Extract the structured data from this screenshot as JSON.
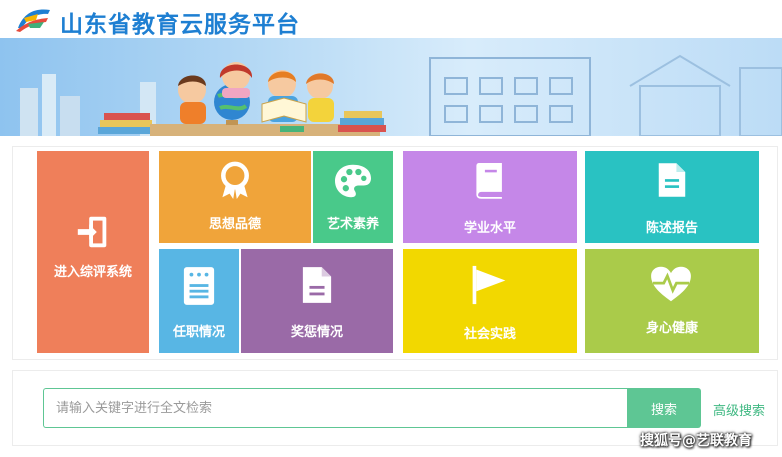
{
  "header": {
    "title": "山东省教育云服务平台"
  },
  "tiles": {
    "enter": {
      "label": "进入综评系统",
      "color": "#ef7f5a",
      "icon": "enter-door-icon"
    },
    "moral": {
      "label": "思想品德",
      "color": "#f0a43a",
      "icon": "award-ribbon-icon"
    },
    "art": {
      "label": "艺术素养",
      "color": "#49c98a",
      "icon": "palette-icon"
    },
    "academic": {
      "label": "学业水平",
      "color": "#c587e8",
      "icon": "book-icon"
    },
    "report": {
      "label": "陈述报告",
      "color": "#29c2c2",
      "icon": "document-icon"
    },
    "duty": {
      "label": "任职情况",
      "color": "#58b6e4",
      "icon": "id-card-icon"
    },
    "reward": {
      "label": "奖惩情况",
      "color": "#9a6aa7",
      "icon": "file-icon"
    },
    "social": {
      "label": "社会实践",
      "color": "#f2d800",
      "icon": "flag-icon"
    },
    "health": {
      "label": "身心健康",
      "color": "#aacb4a",
      "icon": "heart-pulse-icon"
    }
  },
  "search": {
    "placeholder": "请输入关键字进行全文检索",
    "value": "",
    "button_label": "搜索",
    "advanced_label": "高级搜索"
  },
  "watermark": "搜狐号@艺联教育"
}
